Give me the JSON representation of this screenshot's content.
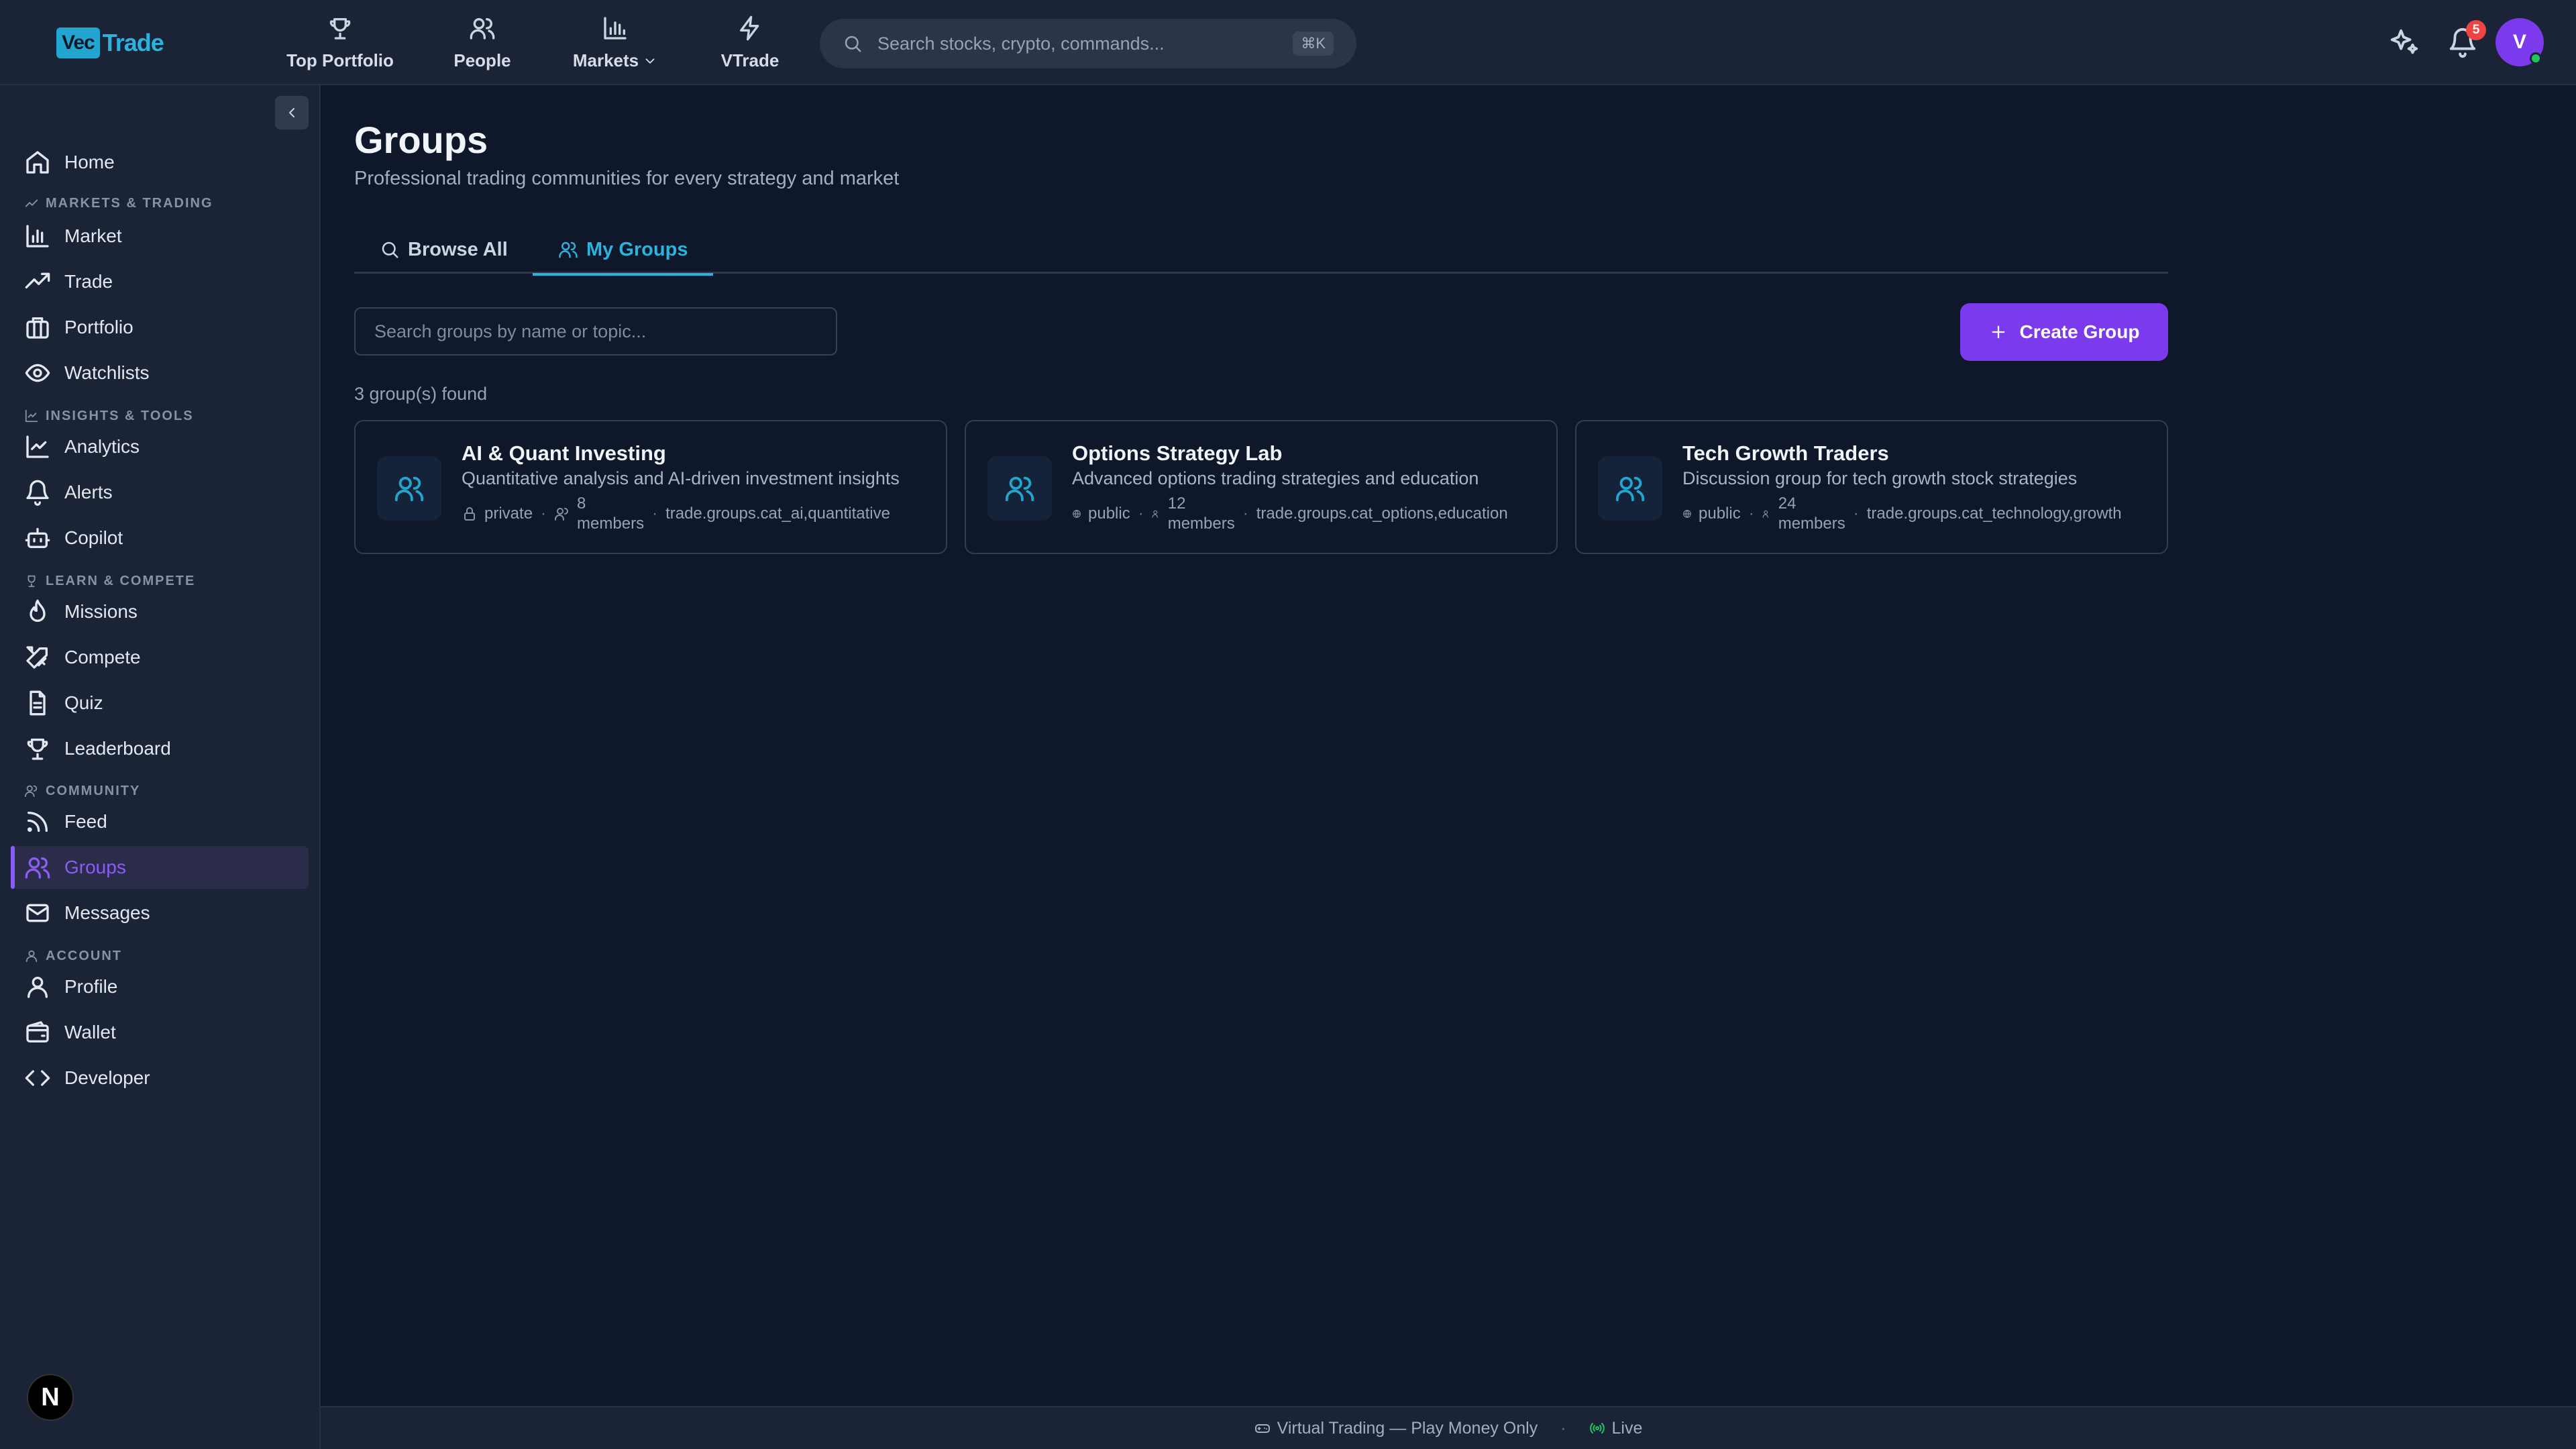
{
  "app": {
    "logo_vec": "Vec",
    "logo_trade": "Trade"
  },
  "topnav": {
    "items": [
      {
        "label": "Top Portfolio",
        "icon": "trophy-icon"
      },
      {
        "label": "People",
        "icon": "users-icon"
      },
      {
        "label": "Markets",
        "icon": "bar-chart-icon"
      },
      {
        "label": "VTrade",
        "icon": "lightning-icon"
      }
    ],
    "search_placeholder": "Search stocks, crypto, commands...",
    "search_shortcut": "⌘K",
    "notification_count": "5",
    "avatar_initial": "V"
  },
  "sidebar": {
    "home": "Home",
    "section_markets": "MARKETS & TRADING",
    "market": "Market",
    "trade": "Trade",
    "portfolio": "Portfolio",
    "watchlists": "Watchlists",
    "section_insights": "INSIGHTS & TOOLS",
    "analytics": "Analytics",
    "alerts": "Alerts",
    "copilot": "Copilot",
    "section_learn": "LEARN & COMPETE",
    "missions": "Missions",
    "compete": "Compete",
    "quiz": "Quiz",
    "leaderboard": "Leaderboard",
    "section_community": "COMMUNITY",
    "feed": "Feed",
    "groups": "Groups",
    "messages": "Messages",
    "section_account": "ACCOUNT",
    "profile": "Profile",
    "wallet": "Wallet",
    "developer": "Developer",
    "active_item": "Groups"
  },
  "main": {
    "title": "Groups",
    "subtitle": "Professional trading communities for every strategy and market",
    "tabs": [
      {
        "label": "Browse All",
        "active": false
      },
      {
        "label": "My Groups",
        "active": true
      }
    ],
    "search_placeholder": "Search groups by name or topic...",
    "create_label": "Create Group",
    "count_text": "3 group(s) found",
    "groups": [
      {
        "name": "AI & Quant Investing",
        "description": "Quantitative analysis and AI-driven investment insights",
        "visibility": "private",
        "members_count": "8",
        "members_label": "members",
        "tags": "trade.groups.cat_ai,quantitative"
      },
      {
        "name": "Options Strategy Lab",
        "description": "Advanced options trading strategies and education",
        "visibility": "public",
        "members_count": "12",
        "members_label": "members",
        "tags": "trade.groups.cat_options,education"
      },
      {
        "name": "Tech Growth Traders",
        "description": "Discussion group for tech growth stock strategies",
        "visibility": "public",
        "members_count": "24",
        "members_label": "members",
        "tags": "trade.groups.cat_technology,growth"
      }
    ]
  },
  "footer": {
    "mode": "Virtual Trading — Play Money Only",
    "sep": "·",
    "status": "Live"
  },
  "colors": {
    "accent": "#7c3aed",
    "brand": "#22a6cf",
    "background": "#0f172a",
    "panel": "#1b2436",
    "live": "#22c55e",
    "notification": "#ef4444"
  }
}
